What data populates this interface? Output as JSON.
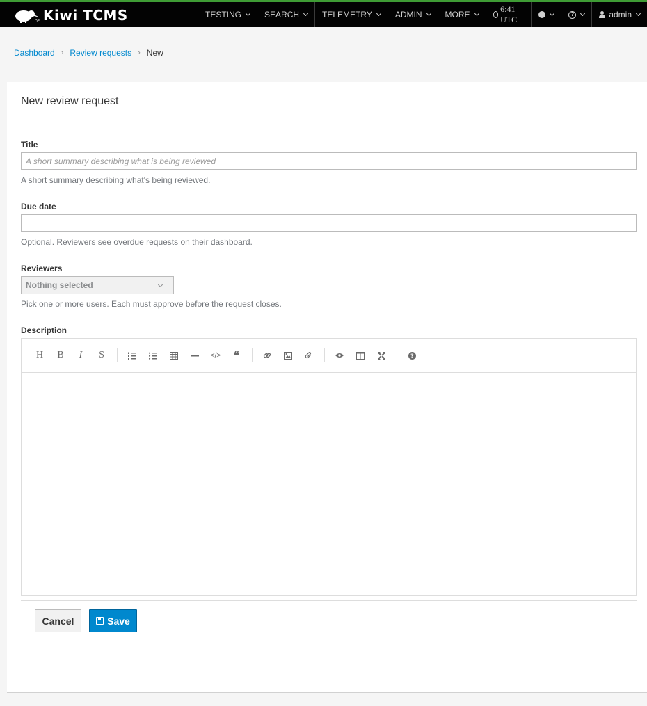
{
  "app": {
    "brand": "Kiwi TCMS"
  },
  "nav": {
    "items": [
      {
        "label": "TESTING"
      },
      {
        "label": "SEARCH"
      },
      {
        "label": "TELEMETRY"
      },
      {
        "label": "ADMIN"
      },
      {
        "label": "MORE"
      }
    ],
    "time": "6:41 UTC",
    "user": "admin"
  },
  "breadcrumb": {
    "items": [
      "Dashboard",
      "Review requests"
    ],
    "current": "New"
  },
  "page": {
    "title": "New review request"
  },
  "form": {
    "title": {
      "label": "Title",
      "placeholder": "A short summary describing what is being reviewed",
      "value": "",
      "help": "A short summary describing what's being reviewed."
    },
    "due_date": {
      "label": "Due date",
      "value": "",
      "help": "Optional. Reviewers see overdue requests on their dashboard."
    },
    "reviewers": {
      "label": "Reviewers",
      "selected": "Nothing selected",
      "help": "Pick one or more users. Each must approve before the request closes."
    },
    "description": {
      "label": "Description",
      "toolbar": [
        "heading-icon",
        "bold-icon",
        "italic-icon",
        "strikethrough-icon",
        "ordered-list-icon",
        "unordered-list-icon",
        "table-icon",
        "horizontal-rule-icon",
        "code-icon",
        "quote-icon",
        "link-icon",
        "image-icon",
        "attachment-icon",
        "preview-icon",
        "side-by-side-icon",
        "fullscreen-icon",
        "help-icon"
      ]
    }
  },
  "actions": {
    "cancel": "Cancel",
    "save": "Save"
  },
  "colors": {
    "accent": "#0088ce",
    "topbar": "#030303",
    "topbar_border": "#3f9c35"
  }
}
